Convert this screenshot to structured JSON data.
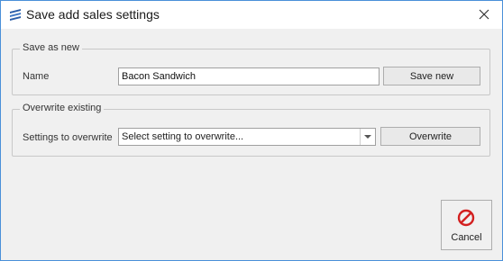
{
  "window": {
    "title": "Save add sales settings"
  },
  "save_as_new": {
    "legend": "Save as new",
    "name_label": "Name",
    "name_value": "Bacon Sandwich",
    "save_button": "Save new"
  },
  "overwrite_existing": {
    "legend": "Overwrite existing",
    "settings_label": "Settings to overwrite",
    "select_placeholder": "Select setting to overwrite...",
    "overwrite_button": "Overwrite"
  },
  "footer": {
    "cancel_label": "Cancel"
  },
  "icons": {
    "app": "app-logo-icon",
    "close": "close-icon",
    "dropdown": "chevron-down-icon",
    "cancel": "cancel-icon"
  },
  "colors": {
    "window_border": "#4a90d9",
    "background": "#f0f0f0",
    "cancel_icon": "#d32020",
    "app_icon": "#2b5ea8"
  }
}
